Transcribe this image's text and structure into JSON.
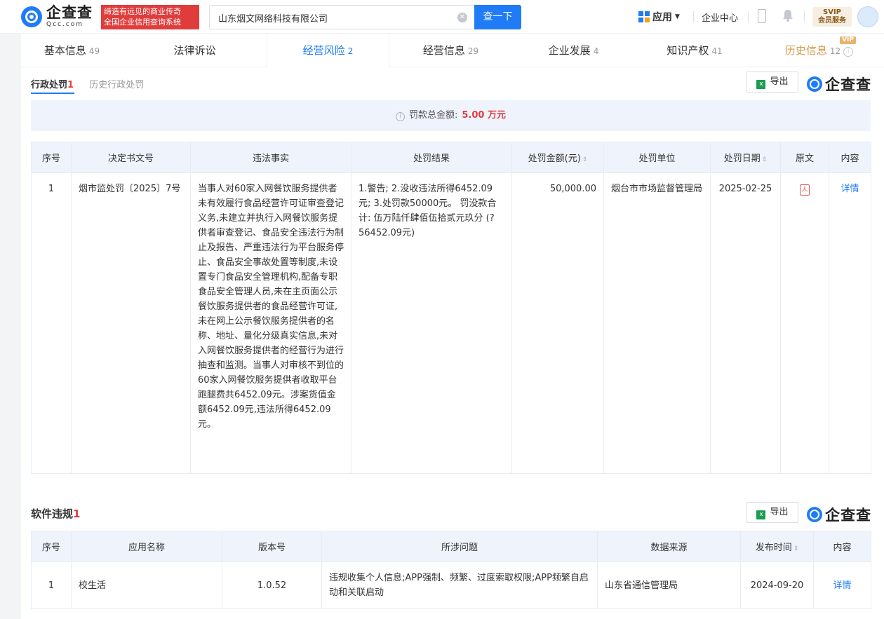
{
  "header": {
    "logo_cn": "企查查",
    "logo_en": "Qcc.com",
    "slogan_line1": "缔造有远见的商业传奇",
    "slogan_line2": "全国企业信用查询系统",
    "search_value": "山东烟文网络科技有限公司",
    "search_button": "查一下",
    "apps_label": "应用",
    "enterprise_center": "企业中心",
    "svip_line1": "SVIP",
    "svip_line2": "会员服务"
  },
  "tabs": [
    {
      "label": "基本信息",
      "count": "49"
    },
    {
      "label": "法律诉讼",
      "count": ""
    },
    {
      "label": "经营风险",
      "count": "2"
    },
    {
      "label": "经营信息",
      "count": "29"
    },
    {
      "label": "企业发展",
      "count": "4"
    },
    {
      "label": "知识产权",
      "count": "41"
    },
    {
      "label": "历史信息",
      "count": "12",
      "badge": "VIP"
    }
  ],
  "penalty": {
    "subtab_active": "行政处罚",
    "subtab_active_count": "1",
    "subtab_history": "历史行政处罚",
    "export_label": "导出",
    "watermark": "企查查",
    "summary_label": "罚款总金额:",
    "summary_amount": "5.00 万元",
    "columns": [
      "序号",
      "决定书文号",
      "违法事实",
      "处罚结果",
      "处罚金额(元)",
      "处罚单位",
      "处罚日期",
      "原文",
      "内容"
    ],
    "rows": [
      {
        "index": "1",
        "doc_no": "烟市监处罚〔2025〕7号",
        "facts": "当事人对60家入网餐饮服务提供者未有效履行食品经营许可证审查登记义务,未建立并执行入网餐饮服务提供者审查登记、食品安全违法行为制止及报告、严重违法行为平台服务停止、食品安全事故处置等制度,未设置专门食品安全管理机构,配备专职食品安全管理人员,未在主页面公示餐饮服务提供者的食品经营许可证,未在网上公示餐饮服务提供者的名称、地址、量化分级真实信息,未对入网餐饮服务提供者的经营行为进行抽查和监测。当事人对审核不到位的60家入网餐饮服务提供者收取平台跑腿费共6452.09元。涉案货值金额6452.09元,违法所得6452.09元。",
        "result": "1.警告; 2.没收违法所得6452.09元; 3.处罚款50000元。 罚没款合计: 伍万陆仟肆佰伍拾贰元玖分 (?56452.09元)",
        "amount": "50,000.00",
        "authority": "烟台市市场监督管理局",
        "date": "2025-02-25",
        "detail": "详情"
      }
    ]
  },
  "software": {
    "title": "软件违规",
    "count": "1",
    "export_label": "导出",
    "watermark": "企查查",
    "columns": [
      "序号",
      "应用名称",
      "版本号",
      "所涉问题",
      "数据来源",
      "发布时间",
      "内容"
    ],
    "rows": [
      {
        "index": "1",
        "app": "校生活",
        "version": "1.0.52",
        "issue": "违规收集个人信息;APP强制、频繁、过度索取权限;APP频繁自启动和关联启动",
        "source": "山东省通信管理局",
        "date": "2024-09-20",
        "detail": "详情"
      }
    ]
  }
}
